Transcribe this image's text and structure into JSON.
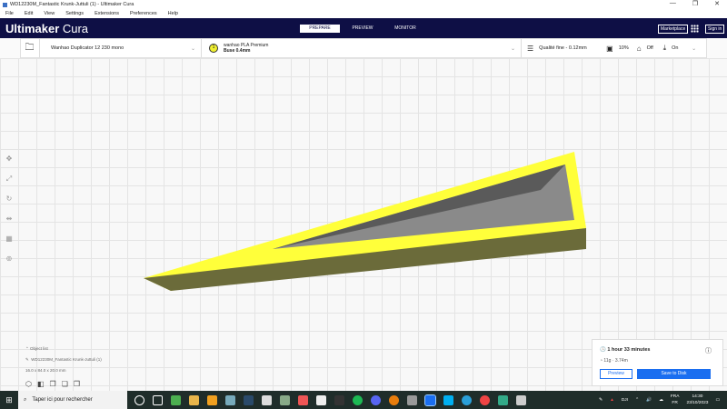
{
  "window": {
    "title": "WD12230M_Fantastic Krunk-Juttuli (1) - Ultimaker Cura",
    "minimize": "—",
    "restore": "❐",
    "close": "✕"
  },
  "menu": [
    "File",
    "Edit",
    "View",
    "Settings",
    "Extensions",
    "Preferences",
    "Help"
  ],
  "header": {
    "logo_bold": "Ultimaker",
    "logo_light": " Cura",
    "tabs": [
      "PREPARE",
      "PREVIEW",
      "MONITOR"
    ],
    "marketplace": "Marketplace",
    "signin": "Sign in"
  },
  "toolbar": {
    "printer": "Wanhao Duplicator 12 230 mono",
    "material_name": "wanhao PLA Premium",
    "nozzle": "Buse 0.4mm",
    "extruder": "1",
    "profile": "Qualité fine - 0.12mm",
    "infill": "10%",
    "support": "Off",
    "adhesion": "On"
  },
  "objects": {
    "header": "Object list",
    "name": "WD12230M_Fantastic Krunk-Juttuli (1)",
    "dimensions": "16.0 x 84.0 x 20.0 mm"
  },
  "print": {
    "time": "1 hour 33 minutes",
    "material": "11g · 3.74m",
    "preview": "Preview",
    "save": "Save to Disk"
  },
  "taskbar": {
    "search": "Taper ici pour rechercher",
    "lang1": "FRA",
    "lang2": "FR",
    "time": "14:30",
    "date": "23/10/2023",
    "app": "DJI"
  },
  "colors": {
    "header": "#0e0f45",
    "accent": "#1a6ef0",
    "model": "#ffff3a"
  }
}
